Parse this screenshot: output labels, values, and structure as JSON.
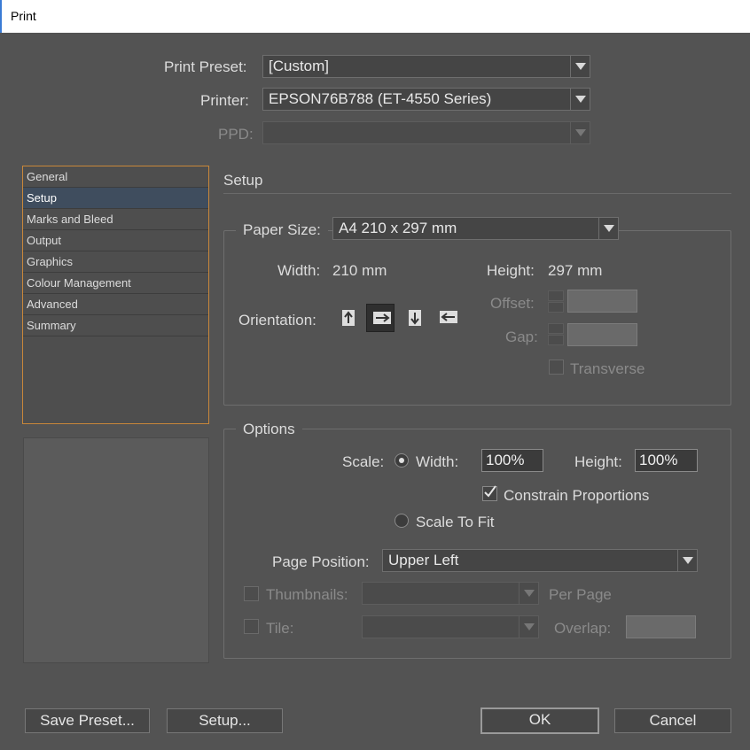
{
  "window": {
    "title": "Print"
  },
  "top": {
    "preset_label": "Print Preset:",
    "preset_value": "[Custom]",
    "printer_label": "Printer:",
    "printer_value": "EPSON76B788 (ET-4550 Series)",
    "ppd_label": "PPD:",
    "ppd_value": ""
  },
  "sidebar": {
    "items": [
      {
        "label": "General"
      },
      {
        "label": "Setup"
      },
      {
        "label": "Marks and Bleed"
      },
      {
        "label": "Output"
      },
      {
        "label": "Graphics"
      },
      {
        "label": "Colour Management"
      },
      {
        "label": "Advanced"
      },
      {
        "label": "Summary"
      }
    ],
    "selected": "Setup"
  },
  "setup": {
    "title": "Setup",
    "paper_size_label": "Paper Size:",
    "paper_size_value": "A4 210 x 297 mm",
    "width_label": "Width:",
    "width_value": "210 mm",
    "height_label": "Height:",
    "height_value": "297 mm",
    "orientation_label": "Orientation:",
    "orientation_icons": [
      "portrait-icon",
      "landscape-icon",
      "reverse-portrait-icon",
      "reverse-landscape-icon"
    ],
    "orientation_selected": "landscape-icon",
    "offset_label": "Offset:",
    "gap_label": "Gap:",
    "transverse_label": "Transverse"
  },
  "options": {
    "title": "Options",
    "scale_label": "Scale:",
    "width_label": "Width:",
    "width_value": "100%",
    "height_label": "Height:",
    "height_value": "100%",
    "constrain_label": "Constrain Proportions",
    "constrain_checked": true,
    "scale_to_fit_label": "Scale To Fit",
    "page_position_label": "Page Position:",
    "page_position_value": "Upper Left",
    "thumbnails_label": "Thumbnails:",
    "per_page_label": "Per Page",
    "tile_label": "Tile:",
    "overlap_label": "Overlap:"
  },
  "buttons": {
    "save_preset": "Save Preset...",
    "setup": "Setup...",
    "ok": "OK",
    "cancel": "Cancel"
  },
  "colors": {
    "dialog_bg": "#535353",
    "sidebar_border": "#c8873a",
    "selected_item_bg": "#3f4d5e"
  }
}
